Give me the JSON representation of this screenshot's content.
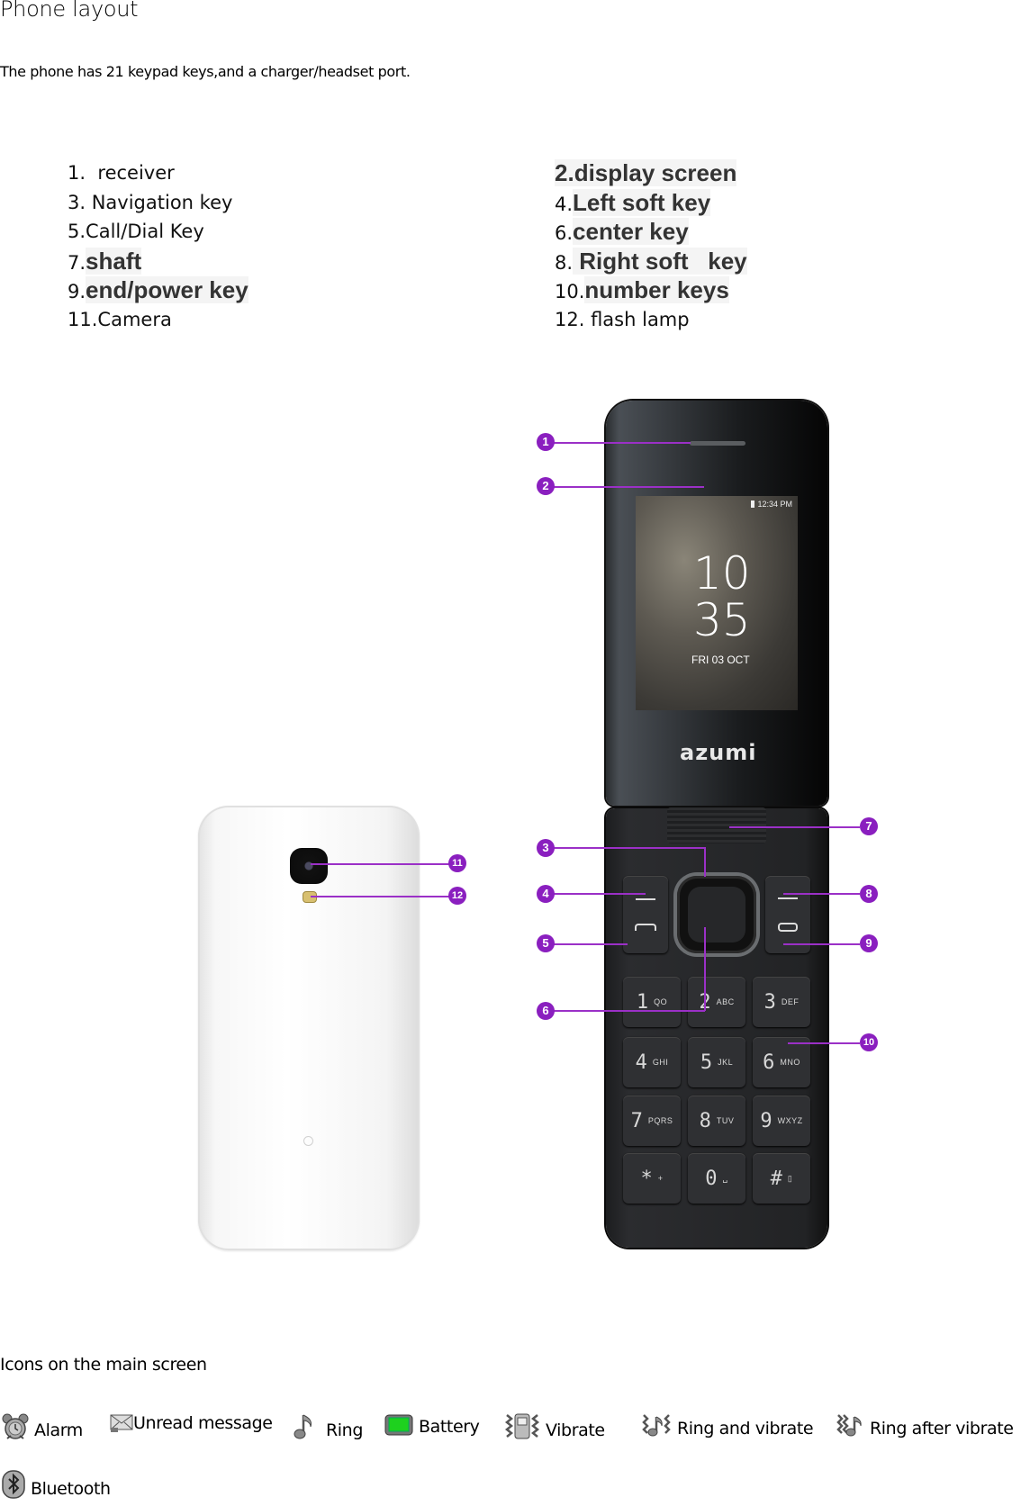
{
  "document": {
    "title": "Phone layout",
    "intro": "The phone has 21 keypad keys,and a charger/headset port."
  },
  "legend": {
    "left": [
      {
        "num": "1.",
        "label": "  receiver",
        "highlight": false
      },
      {
        "num": "3.",
        "label": " Navigation key",
        "highlight": false
      },
      {
        "num": "5.",
        "label": "Call/Dial Key",
        "highlight": false
      },
      {
        "num": "7.",
        "label": "shaft",
        "highlight": true
      },
      {
        "num": "9.",
        "label": "end/power key",
        "highlight": true
      },
      {
        "num": "11.",
        "label": "Camera",
        "highlight": false
      }
    ],
    "right": [
      {
        "num": "2.",
        "label": "display screen",
        "highlight": true
      },
      {
        "num": "4.",
        "label": "Left soft key",
        "highlight": true
      },
      {
        "num": "6.",
        "label": "center key",
        "highlight": true
      },
      {
        "num": "8.",
        "label": " Right soft   key",
        "highlight": true
      },
      {
        "num": "10.",
        "label": "number keys",
        "highlight": true
      },
      {
        "num": "12.",
        "label": " flash lamp",
        "highlight": false
      }
    ]
  },
  "phone": {
    "brand": "azumi",
    "screen": {
      "status_time": "12:34 PM",
      "clock_hour": "10",
      "clock_minute": "35",
      "date": "FRI 03 OCT"
    },
    "keypad": [
      {
        "digit": "1",
        "letters": "QO"
      },
      {
        "digit": "2",
        "letters": "ABC"
      },
      {
        "digit": "3",
        "letters": "DEF"
      },
      {
        "digit": "4",
        "letters": "GHI"
      },
      {
        "digit": "5",
        "letters": "JKL"
      },
      {
        "digit": "6",
        "letters": "MNO"
      },
      {
        "digit": "7",
        "letters": "PQRS"
      },
      {
        "digit": "8",
        "letters": "TUV"
      },
      {
        "digit": "9",
        "letters": "WXYZ"
      },
      {
        "digit": "*",
        "letters": "+"
      },
      {
        "digit": "0",
        "letters": "␣"
      },
      {
        "digit": "#",
        "letters": "▯"
      }
    ],
    "callouts": [
      "1",
      "2",
      "3",
      "4",
      "5",
      "6",
      "7",
      "8",
      "9",
      "10",
      "11",
      "12"
    ],
    "accent_color": "#8a1fbf"
  },
  "icons_section": {
    "heading": "Icons on the main screen",
    "items": [
      {
        "icon": "alarm-icon",
        "label": "Alarm"
      },
      {
        "icon": "unread-message-icon",
        "label": "Unread message"
      },
      {
        "icon": "ring-icon",
        "label": "Ring"
      },
      {
        "icon": "battery-icon",
        "label": "Battery"
      },
      {
        "icon": "vibrate-icon",
        "label": "Vibrate"
      },
      {
        "icon": "ring-and-vibrate-icon",
        "label": "Ring and vibrate"
      },
      {
        "icon": "ring-after-vibrate-icon",
        "label": "Ring after vibrate"
      },
      {
        "icon": "bluetooth-icon",
        "label": "Bluetooth"
      }
    ]
  }
}
